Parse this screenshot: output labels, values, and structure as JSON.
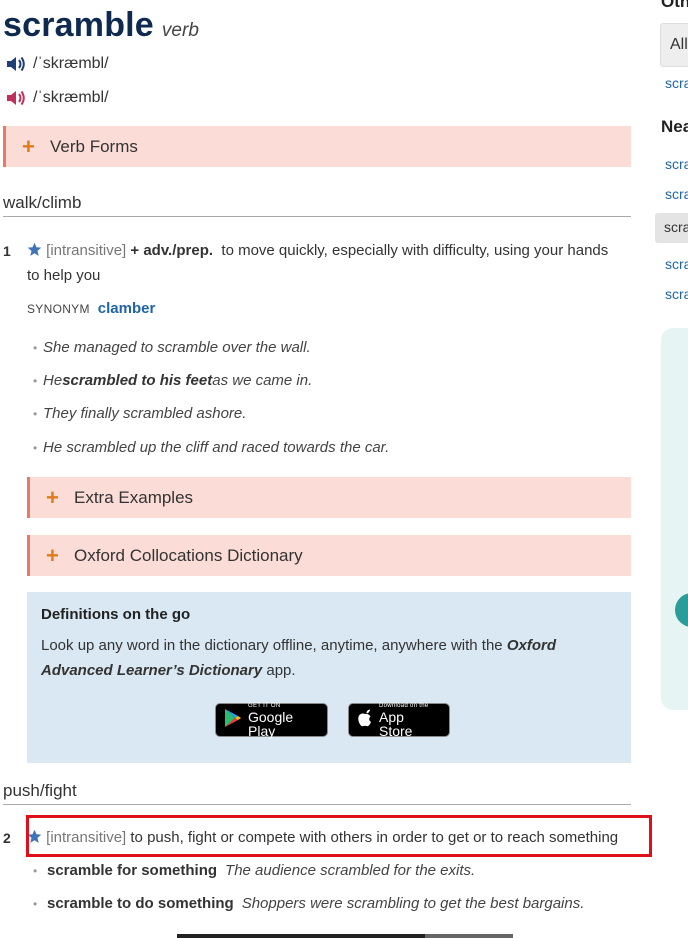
{
  "entry": {
    "headword": "scramble",
    "pos": "verb",
    "pron_br": "/ˈskræmbl/",
    "pron_us": "/ˈskræmbl/"
  },
  "collapsibles": {
    "verb_forms": "Verb Forms",
    "extra_examples": "Extra Examples",
    "collocations": "Oxford Collocations Dictionary"
  },
  "senses": [
    {
      "shortcut": "walk/climb",
      "num": "1",
      "grammar": "[intransitive]",
      "cf": "+ adv./prep.",
      "definition": "to move quickly, especially with difficulty, using your hands",
      "definition_cont": "to help you",
      "synonym_label": "SYNONYM",
      "synonym": "clamber",
      "examples": [
        {
          "text": "She managed to scramble over the wall."
        },
        {
          "pre": "He ",
          "bold": "scrambled to his feet",
          "post": " as we came in."
        },
        {
          "text": "They finally scrambled ashore."
        },
        {
          "text": "He scrambled up the cliff and raced towards the car."
        }
      ]
    },
    {
      "shortcut": "push/fight",
      "num": "2",
      "grammar": "[intransitive]",
      "definition": "to push, fight or compete with others in order to get or to reach something",
      "patterns": [
        {
          "cf": "scramble for something",
          "example": "The audience scrambled for the exits."
        },
        {
          "cf": "scramble to do something",
          "example": "Shoppers were scrambling to get the best bargains."
        }
      ]
    }
  ],
  "promo": {
    "title": "Definitions on the go",
    "text_pre": "Look up any word in the dictionary offline, anytime, anywhere with the ",
    "app_name_1": "Oxford",
    "app_name_2": "Advanced Learner’s Dictionary",
    "text_post": " app.",
    "google_small": "GET IT ON",
    "google_big": "Google Play",
    "apple_small": "Download on the",
    "apple_big": "App Store"
  },
  "sidebar": {
    "heading_1": "Oth",
    "select_value": "All",
    "link_1": "scra",
    "heading_2": "Nea",
    "near_links": [
      "scra",
      "scra",
      "scra",
      "scra",
      "scra"
    ]
  },
  "colors": {
    "headword": "#0e2a4f",
    "collapsible_bg": "#fbdcd6",
    "accent_orange": "#e07b1a",
    "link_blue": "#1f64a8",
    "promo_bg": "#d9e8f2",
    "highlight": "#e0101b"
  }
}
